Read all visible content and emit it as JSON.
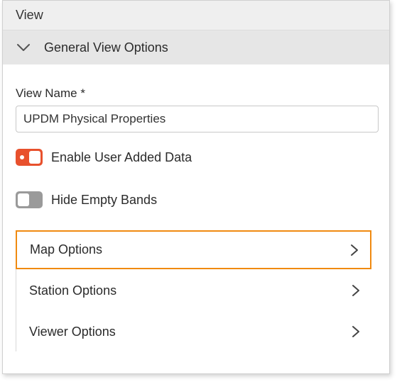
{
  "panel": {
    "title": "View"
  },
  "section": {
    "title": "General View Options",
    "expanded": true
  },
  "view_name": {
    "label": "View Name *",
    "value": "UPDM Physical Properties"
  },
  "toggles": [
    {
      "label": "Enable User Added Data",
      "state": "on",
      "color": "#e8512d"
    },
    {
      "label": "Hide Empty Bands",
      "state": "off",
      "color": "#9a9a9a"
    }
  ],
  "options": [
    {
      "label": "Map Options",
      "selected": true
    },
    {
      "label": "Station Options",
      "selected": false
    },
    {
      "label": "Viewer Options",
      "selected": false
    }
  ],
  "colors": {
    "accent_selected": "#f08a10",
    "toggle_on": "#e8512d"
  }
}
